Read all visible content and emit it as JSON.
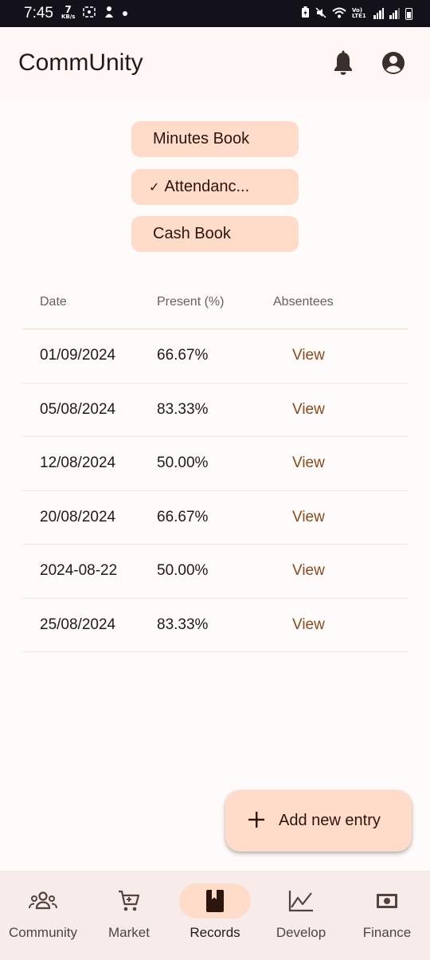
{
  "status_bar": {
    "time": "7:45",
    "net_speed_value": "7",
    "net_speed_unit": "KB/s",
    "network_label": "Vo) LTE1"
  },
  "app_bar": {
    "title": "CommUnity"
  },
  "books": [
    {
      "label": "Minutes Book",
      "selected": false
    },
    {
      "label": "Attendanc...",
      "selected": true
    },
    {
      "label": "Cash Book",
      "selected": false
    }
  ],
  "table": {
    "headers": [
      "Date",
      "Present (%)",
      "Absentees"
    ],
    "rows": [
      {
        "date": "01/09/2024",
        "present": "66.67%",
        "absentees": "View"
      },
      {
        "date": "05/08/2024",
        "present": "83.33%",
        "absentees": "View"
      },
      {
        "date": "12/08/2024",
        "present": "50.00%",
        "absentees": "View"
      },
      {
        "date": "20/08/2024",
        "present": "66.67%",
        "absentees": "View"
      },
      {
        "date": "2024-08-22",
        "present": "50.00%",
        "absentees": "View"
      },
      {
        "date": "25/08/2024",
        "present": "83.33%",
        "absentees": "View"
      }
    ]
  },
  "fab": {
    "label": "Add new entry",
    "icon": "plus-icon"
  },
  "bottom_nav": {
    "items": [
      {
        "label": "Community",
        "icon": "groups-icon",
        "active": false
      },
      {
        "label": "Market",
        "icon": "cart-icon",
        "active": false
      },
      {
        "label": "Records",
        "icon": "book-icon",
        "active": true
      },
      {
        "label": "Develop",
        "icon": "trend-icon",
        "active": false
      },
      {
        "label": "Finance",
        "icon": "money-icon",
        "active": false
      }
    ]
  },
  "colors": {
    "accent_container": "#ffdbca",
    "link": "#8b4a1c",
    "surface": "#fffbfa",
    "nav_background": "#f7ece9"
  }
}
